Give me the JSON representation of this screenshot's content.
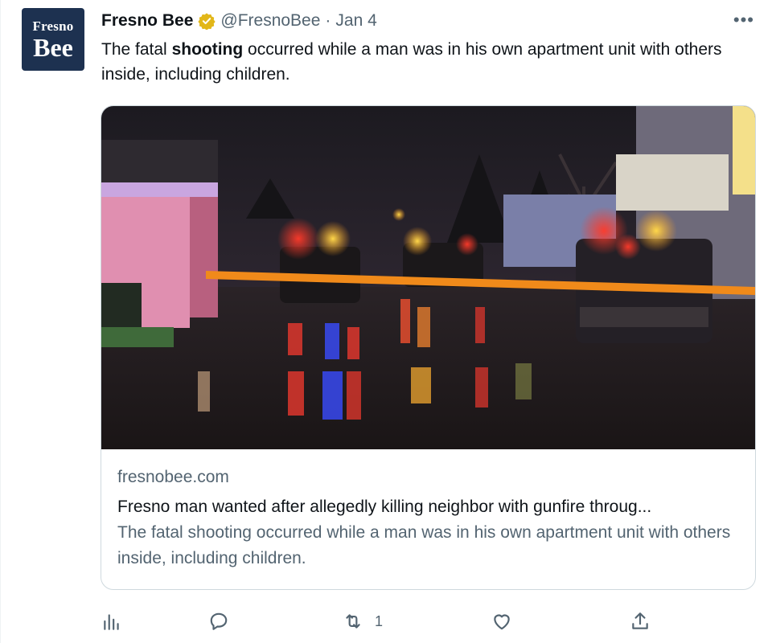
{
  "account": {
    "avatar_line1": "Fresno",
    "avatar_line2": "Bee",
    "name": "Fresno Bee",
    "handle": "@FresnoBee",
    "separator": "·",
    "date": "Jan 4",
    "verified_badge_color": "#e2b719"
  },
  "tweet": {
    "text_before": "The fatal ",
    "text_bold": "shooting",
    "text_after": " occurred while a man was in his own apartment unit with others inside, including children."
  },
  "card": {
    "domain": "fresnobee.com",
    "title": "Fresno man wanted after allegedly killing neighbor with gunfire throug...",
    "description": "The fatal shooting occurred while a man was in his own apartment unit with others inside, including children."
  },
  "actions": {
    "analytics_icon": "analytics-icon",
    "reply_icon": "reply-icon",
    "retweet_icon": "retweet-icon",
    "retweet_count": "1",
    "like_icon": "like-icon",
    "share_icon": "share-icon"
  },
  "more_label": "•••",
  "colors": {
    "text": "#0f1419",
    "secondary": "#536471",
    "border": "#cfd9de",
    "avatar_bg": "#1d3150"
  }
}
